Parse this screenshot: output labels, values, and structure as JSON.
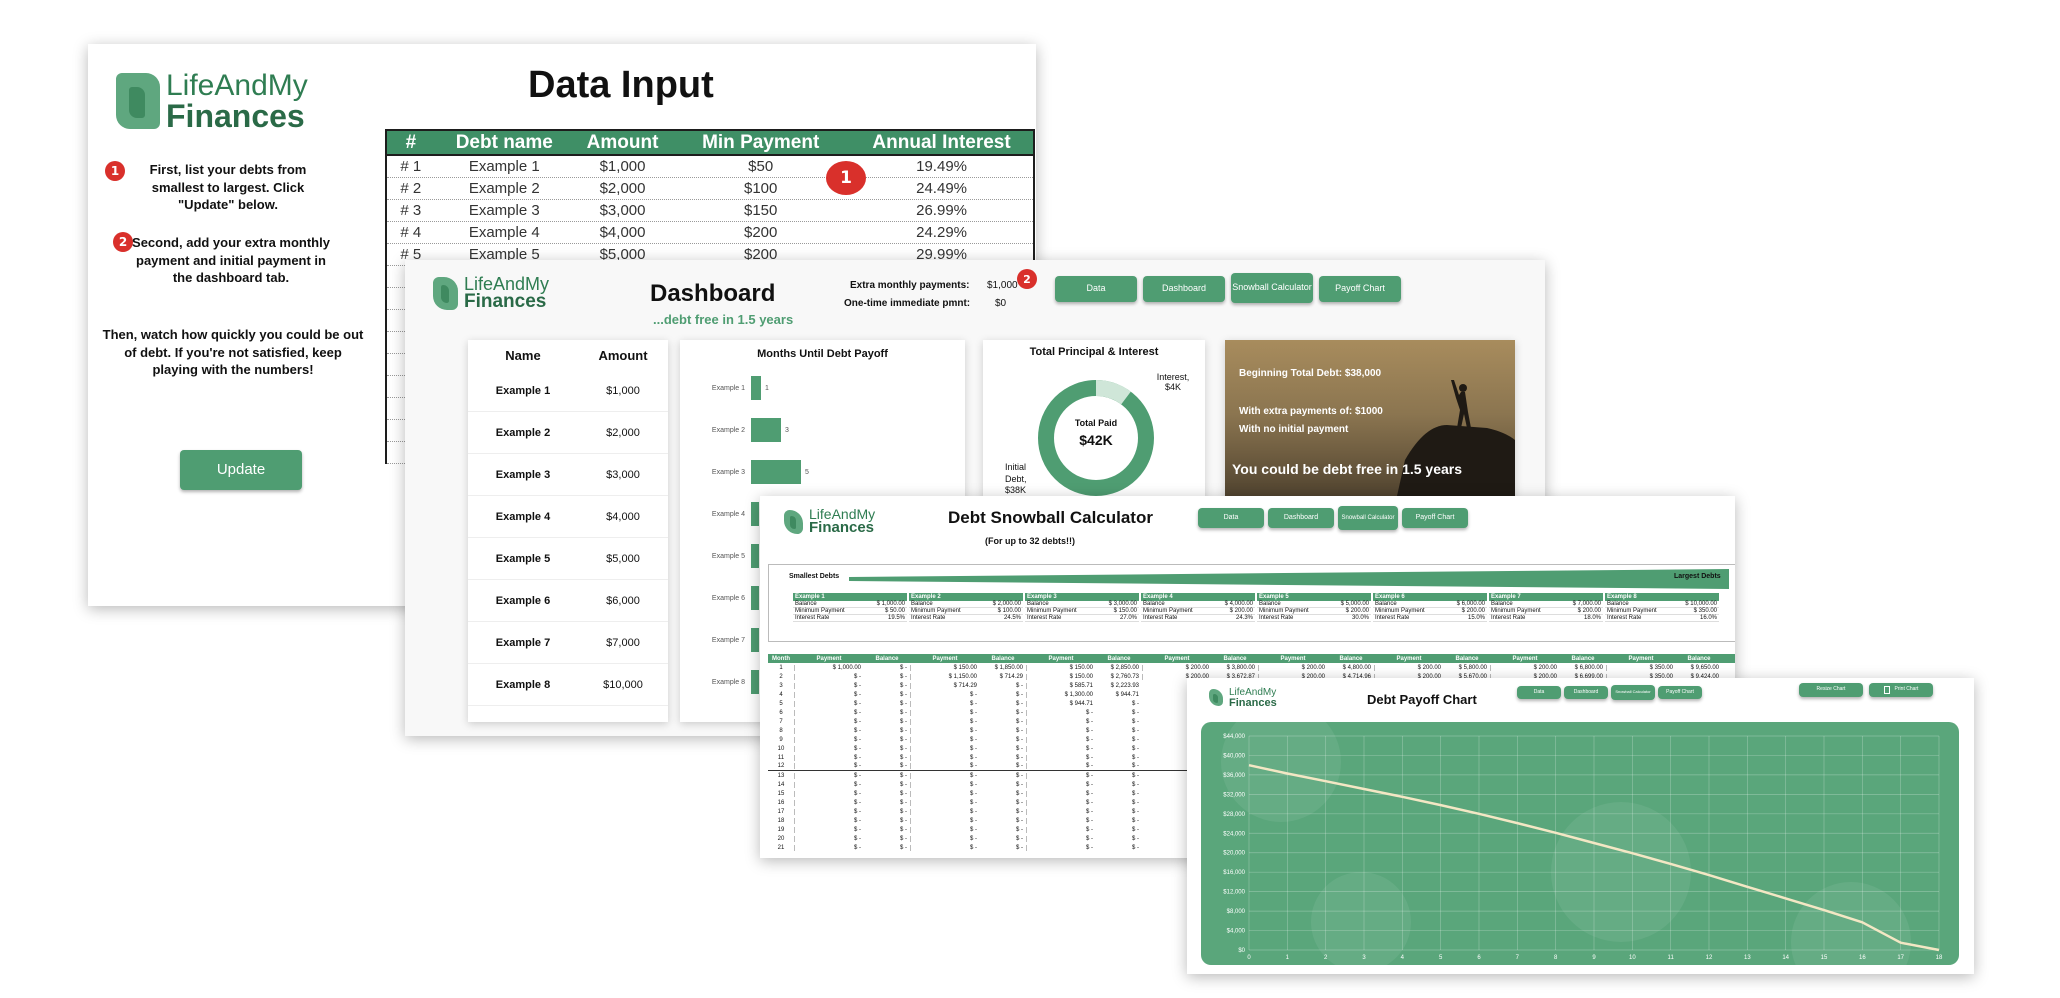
{
  "brand": {
    "top": "LifeAndMy",
    "bottom": "Finances"
  },
  "data_input": {
    "title": "Data Input",
    "instruction_1_num": "1",
    "instruction_1": "First, list your debts from smallest to largest. Click \"Update\" below.",
    "instruction_2_num": "2",
    "instruction_2": "Second, add your extra monthly payment and initial payment in the dashboard tab.",
    "instruction_3": "Then, watch how quickly you could be out of debt. If you're not satisfied, keep playing with the numbers!",
    "update_button": "Update",
    "table_badge": "1",
    "columns": [
      "#",
      "Debt name",
      "Amount",
      "Min Payment",
      "Annual Interest"
    ],
    "rows": [
      [
        "# 1",
        "Example 1",
        "$1,000",
        "$50",
        "19.49%"
      ],
      [
        "# 2",
        "Example 2",
        "$2,000",
        "$100",
        "24.49%"
      ],
      [
        "# 3",
        "Example 3",
        "$3,000",
        "$150",
        "26.99%"
      ],
      [
        "# 4",
        "Example 4",
        "$4,000",
        "$200",
        "24.29%"
      ],
      [
        "# 5",
        "Example 5",
        "$5,000",
        "$200",
        "29.99%"
      ],
      [
        "#",
        "",
        "",
        "",
        ""
      ],
      [
        "#",
        "",
        "",
        "",
        ""
      ],
      [
        "#",
        "",
        "",
        "",
        ""
      ],
      [
        "#",
        "",
        "",
        "",
        ""
      ],
      [
        "#",
        "",
        "",
        "",
        ""
      ],
      [
        "#",
        "",
        "",
        "",
        ""
      ],
      [
        "#",
        "",
        "",
        "",
        ""
      ],
      [
        "#",
        "",
        "",
        "",
        ""
      ],
      [
        "#",
        "",
        "",
        "",
        ""
      ]
    ]
  },
  "dashboard": {
    "title": "Dashboard",
    "subtitle": "...debt free in 1.5 years",
    "extra_label": "Extra monthly payments:",
    "extra_value": "$1,000",
    "extra_badge": "2",
    "onetime_label": "One-time immediate pmnt:",
    "onetime_value": "$0",
    "nav": [
      "Data",
      "Dashboard",
      "Snowball Calculator",
      "Payoff Chart"
    ],
    "table_head": {
      "name": "Name",
      "amount": "Amount"
    },
    "table_rows": [
      [
        "Example 1",
        "$1,000"
      ],
      [
        "Example 2",
        "$2,000"
      ],
      [
        "Example 3",
        "$3,000"
      ],
      [
        "Example 4",
        "$4,000"
      ],
      [
        "Example 5",
        "$5,000"
      ],
      [
        "Example 6",
        "$6,000"
      ],
      [
        "Example 7",
        "$7,000"
      ],
      [
        "Example 8",
        "$10,000"
      ]
    ],
    "months_title": "Months Until Debt Payoff",
    "months_labels": [
      "Example 1",
      "Example 2",
      "Example 3",
      "Example 4",
      "Example 5",
      "Example 6",
      "Example 7",
      "Example 8"
    ],
    "months_values": [
      "1",
      "3",
      "5",
      "",
      "",
      "",
      "",
      ""
    ],
    "donut_title": "Total Principal & Interest",
    "donut_center_label": "Total Paid",
    "donut_center_value": "$42K",
    "donut_interest_label": "Interest, $4K",
    "donut_initial_label": "Initial Debt, $38K",
    "photo_lines": [
      "Beginning Total Debt: $38,000",
      "With extra payments of: $1000",
      "With no initial payment"
    ],
    "photo_headline": "You could be debt free in 1.5 years"
  },
  "snowball": {
    "title": "Debt Snowball Calculator",
    "subtitle": "(For up to 32 debts!!)",
    "nav": [
      "Data",
      "Dashboard",
      "Snowball Calculator",
      "Payoff Chart"
    ],
    "smallest": "Smallest Debts",
    "largest": "Largest Debts",
    "debt_headers": [
      "Example 1",
      "Example 2",
      "Example 3",
      "Example 4",
      "Example 5",
      "Example 6",
      "Example 7",
      "Example 8"
    ],
    "field_labels": [
      "Balance",
      "Minimum Payment",
      "Interest Rate"
    ],
    "debt_fields": [
      [
        "$ 1,000.00",
        "$ 50.00",
        "19.5%"
      ],
      [
        "$ 2,000.00",
        "$ 100.00",
        "24.5%"
      ],
      [
        "$ 3,000.00",
        "$ 150.00",
        "27.0%"
      ],
      [
        "$ 4,000.00",
        "$ 200.00",
        "24.3%"
      ],
      [
        "$ 5,000.00",
        "$ 200.00",
        "30.0%"
      ],
      [
        "$ 6,000.00",
        "$ 200.00",
        "15.0%"
      ],
      [
        "$ 7,000.00",
        "$ 200.00",
        "18.0%"
      ],
      [
        "$ 10,000.00",
        "$ 350.00",
        "16.0%"
      ]
    ],
    "month_head": "Month",
    "payment_head": "Payment",
    "balance_head": "Balance",
    "months": [
      "1",
      "2",
      "3",
      "4",
      "5",
      "6",
      "7",
      "8",
      "9",
      "10",
      "11",
      "12",
      "13",
      "14",
      "15",
      "16",
      "17",
      "18",
      "19",
      "20",
      "21"
    ],
    "sample_cells": [
      [
        "$ 1,000.00",
        "$ -",
        "$ 150.00",
        "$ 1,850.00",
        "$ 150.00",
        "$ 2,850.00",
        "$ 200.00",
        "$ 3,800.00",
        "$ 200.00",
        "$ 4,800.00",
        "$ 200.00",
        "$ 5,800.00",
        "$ 200.00",
        "$ 6,800.00",
        "$ 350.00",
        "$ 9,650.00"
      ],
      [
        "$ -",
        "$ -",
        "$ 1,150.00",
        "$ 714.29",
        "$ 150.00",
        "$ 2,760.73",
        "$ 200.00",
        "$ 3,672.87",
        "$ 200.00",
        "$ 4,714.96",
        "$ 200.00",
        "$ 5,670.00",
        "$ 200.00",
        "$ 6,699.00",
        "$ 350.00",
        "$ 9,424.00"
      ],
      [
        "$ -",
        "$ -",
        "$ 714.29",
        "$ -",
        "$ 585.71",
        "$ 2,223.93",
        "",
        "",
        "",
        "",
        "",
        "",
        "",
        "",
        "",
        ""
      ],
      [
        "$ -",
        "$ -",
        "$ -",
        "$ -",
        "$ 1,300.00",
        "$ 944.71",
        "",
        "",
        "",
        "",
        "",
        "",
        "",
        "",
        "",
        ""
      ],
      [
        "$ -",
        "$ -",
        "$ -",
        "$ -",
        "$ 944.71",
        "$ -",
        "",
        "",
        "",
        "",
        "",
        "",
        "",
        "",
        "",
        ""
      ]
    ]
  },
  "payoff": {
    "title": "Debt Payoff Chart",
    "nav": [
      "Data",
      "Dashboard",
      "Snowball Calculator",
      "Payoff Chart"
    ],
    "resize_button": "Resize Chart",
    "print_button": "Print Chart",
    "colors": {
      "bg": "#5aa67b",
      "line": "#f3e7c4"
    }
  },
  "chart_data": {
    "type": "line",
    "title": "",
    "xlabel": "",
    "ylabel": "",
    "x": [
      0,
      1,
      2,
      3,
      4,
      5,
      6,
      7,
      8,
      9,
      10,
      11,
      12,
      13,
      14,
      15,
      16,
      17,
      18
    ],
    "series": [
      {
        "values": [
          38000,
          36300,
          34700,
          33100,
          31500,
          29800,
          28000,
          26100,
          24100,
          22000,
          19900,
          17700,
          15400,
          13000,
          10600,
          8200,
          5700,
          1500,
          0
        ]
      }
    ],
    "y_ticks": [
      "$0",
      "$4,000",
      "$8,000",
      "$12,000",
      "$16,000",
      "$20,000",
      "$24,000",
      "$28,000",
      "$32,000",
      "$36,000",
      "$40,000",
      "$44,000"
    ],
    "x_ticks": [
      "0",
      "1",
      "2",
      "3",
      "4",
      "5",
      "6",
      "7",
      "8",
      "9",
      "10",
      "11",
      "12",
      "13",
      "14",
      "15",
      "16",
      "17",
      "18"
    ],
    "ylim": [
      0,
      44000
    ],
    "xlim": [
      0,
      18
    ],
    "grid": true
  }
}
